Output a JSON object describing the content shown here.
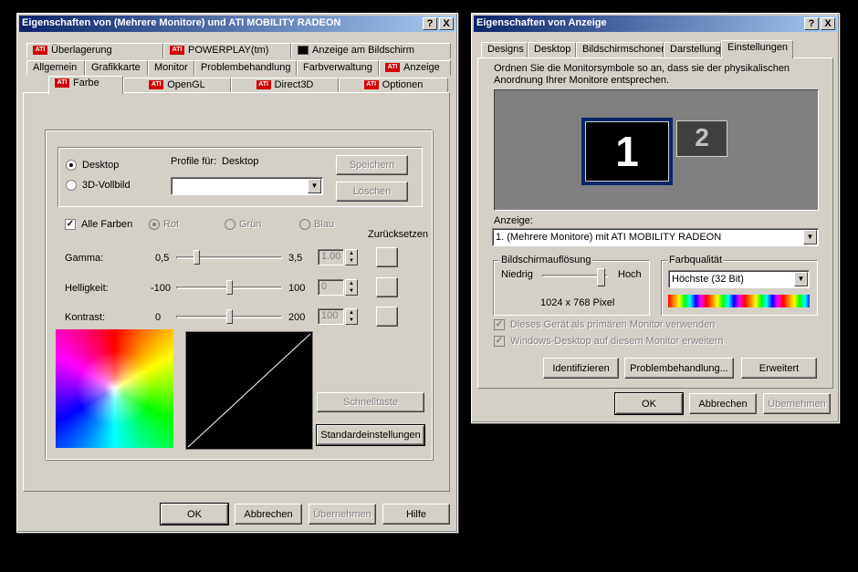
{
  "left_window": {
    "title": "Eigenschaften von (Mehrere Monitore) und ATI MOBILITY RADEON",
    "tabs_row1": [
      "Überlagerung",
      "POWERPLAY(tm)",
      "Anzeige am Bildschirm"
    ],
    "tabs_row2": [
      "Allgemein",
      "Grafikkarte",
      "Monitor",
      "Problembehandlung",
      "Farbverwaltung",
      "Anzeige"
    ],
    "tabs_row3": [
      "Farbe",
      "OpenGL",
      "Direct3D",
      "Optionen"
    ],
    "active_tab": "Farbe",
    "ati_badge": "ATI",
    "radio_desktop": "Desktop",
    "radio_3d": "3D-Vollbild",
    "profile_label": "Profile für:",
    "profile_value": "Desktop",
    "save_button": "Speichern",
    "delete_button": "Löschen",
    "all_colors": "Alle Farben",
    "red": "Rot",
    "green": "Grün",
    "blue": "Blau",
    "reset_label": "Zurücksetzen",
    "gamma": {
      "label": "Gamma:",
      "min": "0,5",
      "max": "3,5",
      "value": "1.00"
    },
    "brightness": {
      "label": "Helligkeit:",
      "min": "-100",
      "max": "100",
      "value": "0"
    },
    "contrast": {
      "label": "Kontrast:",
      "min": "0",
      "max": "200",
      "value": "100"
    },
    "hotkey_button": "Schnelltaste",
    "defaults_button": "Standardeinstellungen",
    "ok": "OK",
    "cancel": "Abbrechen",
    "apply": "Übernehmen",
    "help": "Hilfe"
  },
  "right_window": {
    "title": "Eigenschaften von Anzeige",
    "tabs": [
      "Designs",
      "Desktop",
      "Bildschirmschoner",
      "Darstellung",
      "Einstellungen"
    ],
    "active_tab": "Einstellungen",
    "instructions": "Ordnen Sie die Monitorsymbole so an, dass sie der physikalischen Anordnung Ihrer Monitore entsprechen.",
    "monitor1": "1",
    "monitor2": "2",
    "display_label": "Anzeige:",
    "display_value": "1. (Mehrere Monitore) mit ATI MOBILITY RADEON",
    "resolution_group": "Bildschirmauflösung",
    "res_low": "Niedrig",
    "res_high": "Hoch",
    "resolution_value": "1024 x 768 Pixel",
    "color_group": "Farbqualität",
    "color_value": "Höchste (32 Bit)",
    "primary_check": "Dieses Gerät als primären Monitor verwenden",
    "extend_check": "Windows-Desktop auf diesem Monitor erweitern",
    "identify_button": "Identifizieren",
    "troubleshoot_button": "Problembehandlung...",
    "advanced_button": "Erweitert",
    "ok": "OK",
    "cancel": "Abbrechen",
    "apply": "Übernehmen"
  },
  "titlebar_buttons": {
    "help": "?",
    "close": "X"
  }
}
